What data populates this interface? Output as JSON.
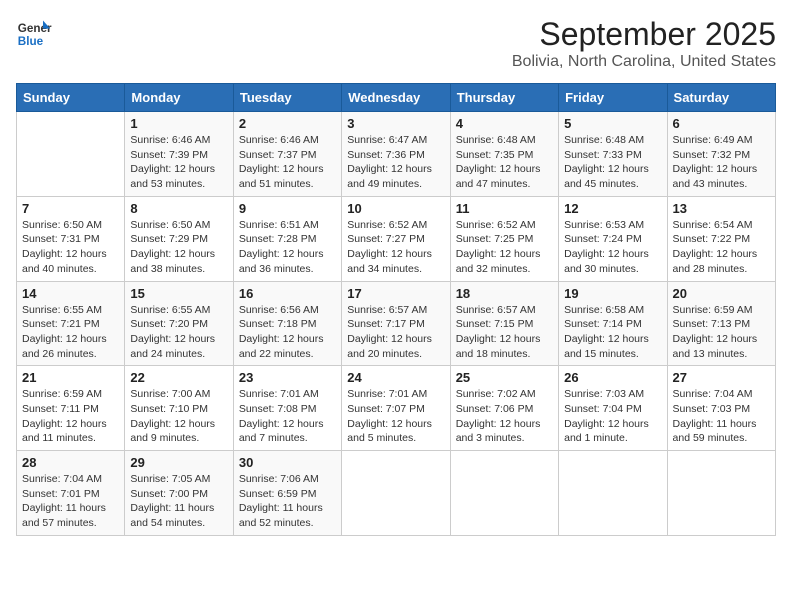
{
  "logo": {
    "text_general": "General",
    "text_blue": "Blue"
  },
  "title": "September 2025",
  "subtitle": "Bolivia, North Carolina, United States",
  "headers": [
    "Sunday",
    "Monday",
    "Tuesday",
    "Wednesday",
    "Thursday",
    "Friday",
    "Saturday"
  ],
  "weeks": [
    [
      {
        "num": "",
        "info": ""
      },
      {
        "num": "1",
        "info": "Sunrise: 6:46 AM\nSunset: 7:39 PM\nDaylight: 12 hours\nand 53 minutes."
      },
      {
        "num": "2",
        "info": "Sunrise: 6:46 AM\nSunset: 7:37 PM\nDaylight: 12 hours\nand 51 minutes."
      },
      {
        "num": "3",
        "info": "Sunrise: 6:47 AM\nSunset: 7:36 PM\nDaylight: 12 hours\nand 49 minutes."
      },
      {
        "num": "4",
        "info": "Sunrise: 6:48 AM\nSunset: 7:35 PM\nDaylight: 12 hours\nand 47 minutes."
      },
      {
        "num": "5",
        "info": "Sunrise: 6:48 AM\nSunset: 7:33 PM\nDaylight: 12 hours\nand 45 minutes."
      },
      {
        "num": "6",
        "info": "Sunrise: 6:49 AM\nSunset: 7:32 PM\nDaylight: 12 hours\nand 43 minutes."
      }
    ],
    [
      {
        "num": "7",
        "info": "Sunrise: 6:50 AM\nSunset: 7:31 PM\nDaylight: 12 hours\nand 40 minutes."
      },
      {
        "num": "8",
        "info": "Sunrise: 6:50 AM\nSunset: 7:29 PM\nDaylight: 12 hours\nand 38 minutes."
      },
      {
        "num": "9",
        "info": "Sunrise: 6:51 AM\nSunset: 7:28 PM\nDaylight: 12 hours\nand 36 minutes."
      },
      {
        "num": "10",
        "info": "Sunrise: 6:52 AM\nSunset: 7:27 PM\nDaylight: 12 hours\nand 34 minutes."
      },
      {
        "num": "11",
        "info": "Sunrise: 6:52 AM\nSunset: 7:25 PM\nDaylight: 12 hours\nand 32 minutes."
      },
      {
        "num": "12",
        "info": "Sunrise: 6:53 AM\nSunset: 7:24 PM\nDaylight: 12 hours\nand 30 minutes."
      },
      {
        "num": "13",
        "info": "Sunrise: 6:54 AM\nSunset: 7:22 PM\nDaylight: 12 hours\nand 28 minutes."
      }
    ],
    [
      {
        "num": "14",
        "info": "Sunrise: 6:55 AM\nSunset: 7:21 PM\nDaylight: 12 hours\nand 26 minutes."
      },
      {
        "num": "15",
        "info": "Sunrise: 6:55 AM\nSunset: 7:20 PM\nDaylight: 12 hours\nand 24 minutes."
      },
      {
        "num": "16",
        "info": "Sunrise: 6:56 AM\nSunset: 7:18 PM\nDaylight: 12 hours\nand 22 minutes."
      },
      {
        "num": "17",
        "info": "Sunrise: 6:57 AM\nSunset: 7:17 PM\nDaylight: 12 hours\nand 20 minutes."
      },
      {
        "num": "18",
        "info": "Sunrise: 6:57 AM\nSunset: 7:15 PM\nDaylight: 12 hours\nand 18 minutes."
      },
      {
        "num": "19",
        "info": "Sunrise: 6:58 AM\nSunset: 7:14 PM\nDaylight: 12 hours\nand 15 minutes."
      },
      {
        "num": "20",
        "info": "Sunrise: 6:59 AM\nSunset: 7:13 PM\nDaylight: 12 hours\nand 13 minutes."
      }
    ],
    [
      {
        "num": "21",
        "info": "Sunrise: 6:59 AM\nSunset: 7:11 PM\nDaylight: 12 hours\nand 11 minutes."
      },
      {
        "num": "22",
        "info": "Sunrise: 7:00 AM\nSunset: 7:10 PM\nDaylight: 12 hours\nand 9 minutes."
      },
      {
        "num": "23",
        "info": "Sunrise: 7:01 AM\nSunset: 7:08 PM\nDaylight: 12 hours\nand 7 minutes."
      },
      {
        "num": "24",
        "info": "Sunrise: 7:01 AM\nSunset: 7:07 PM\nDaylight: 12 hours\nand 5 minutes."
      },
      {
        "num": "25",
        "info": "Sunrise: 7:02 AM\nSunset: 7:06 PM\nDaylight: 12 hours\nand 3 minutes."
      },
      {
        "num": "26",
        "info": "Sunrise: 7:03 AM\nSunset: 7:04 PM\nDaylight: 12 hours\nand 1 minute."
      },
      {
        "num": "27",
        "info": "Sunrise: 7:04 AM\nSunset: 7:03 PM\nDaylight: 11 hours\nand 59 minutes."
      }
    ],
    [
      {
        "num": "28",
        "info": "Sunrise: 7:04 AM\nSunset: 7:01 PM\nDaylight: 11 hours\nand 57 minutes."
      },
      {
        "num": "29",
        "info": "Sunrise: 7:05 AM\nSunset: 7:00 PM\nDaylight: 11 hours\nand 54 minutes."
      },
      {
        "num": "30",
        "info": "Sunrise: 7:06 AM\nSunset: 6:59 PM\nDaylight: 11 hours\nand 52 minutes."
      },
      {
        "num": "",
        "info": ""
      },
      {
        "num": "",
        "info": ""
      },
      {
        "num": "",
        "info": ""
      },
      {
        "num": "",
        "info": ""
      }
    ]
  ]
}
